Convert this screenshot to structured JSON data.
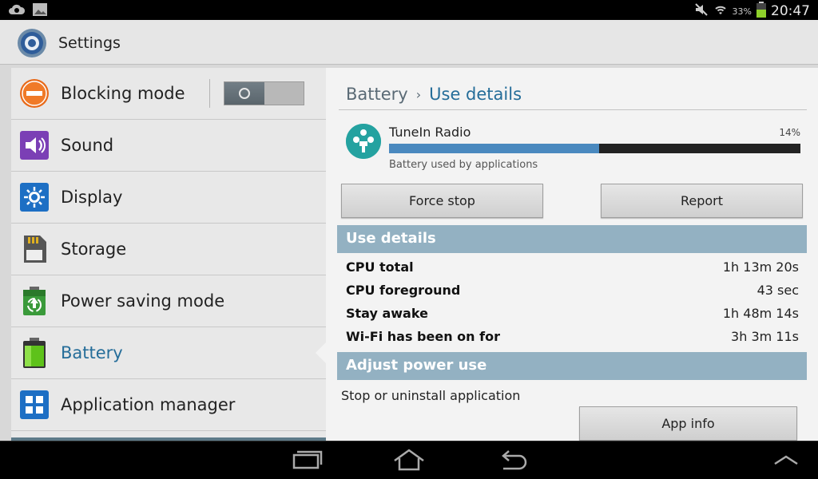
{
  "status_bar": {
    "battery_percent": "33%",
    "time": "20:47"
  },
  "action_bar": {
    "title": "Settings"
  },
  "sidebar": {
    "items": [
      {
        "label": "Blocking mode",
        "icon": "blocking-mode-icon",
        "toggle": false
      },
      {
        "label": "Sound",
        "icon": "sound-icon"
      },
      {
        "label": "Display",
        "icon": "display-icon"
      },
      {
        "label": "Storage",
        "icon": "storage-icon"
      },
      {
        "label": "Power saving mode",
        "icon": "power-saving-icon"
      },
      {
        "label": "Battery",
        "icon": "battery-icon",
        "active": true
      },
      {
        "label": "Application manager",
        "icon": "application-manager-icon"
      }
    ]
  },
  "breadcrumb": {
    "parent": "Battery",
    "separator": "›",
    "current": "Use details"
  },
  "app": {
    "name": "TuneIn Radio",
    "percent_label": "14%",
    "bar_fraction": 0.51,
    "subtitle": "Battery used by applications"
  },
  "buttons": {
    "force_stop": "Force stop",
    "report": "Report",
    "app_info": "App info"
  },
  "use_details": {
    "header": "Use details",
    "rows": [
      {
        "label": "CPU total",
        "value": "1h 13m 20s"
      },
      {
        "label": "CPU foreground",
        "value": "43 sec"
      },
      {
        "label": "Stay awake",
        "value": "1h 48m 14s"
      },
      {
        "label": "Wi-Fi has been on for",
        "value": "3h 3m 11s"
      }
    ]
  },
  "adjust_power": {
    "header": "Adjust power use",
    "text": "Stop or uninstall application"
  },
  "colors": {
    "accent": "#256d99",
    "section_header": "#93b1c2",
    "bar_fill": "#4a89bf",
    "tunein": "#24a2a0"
  }
}
